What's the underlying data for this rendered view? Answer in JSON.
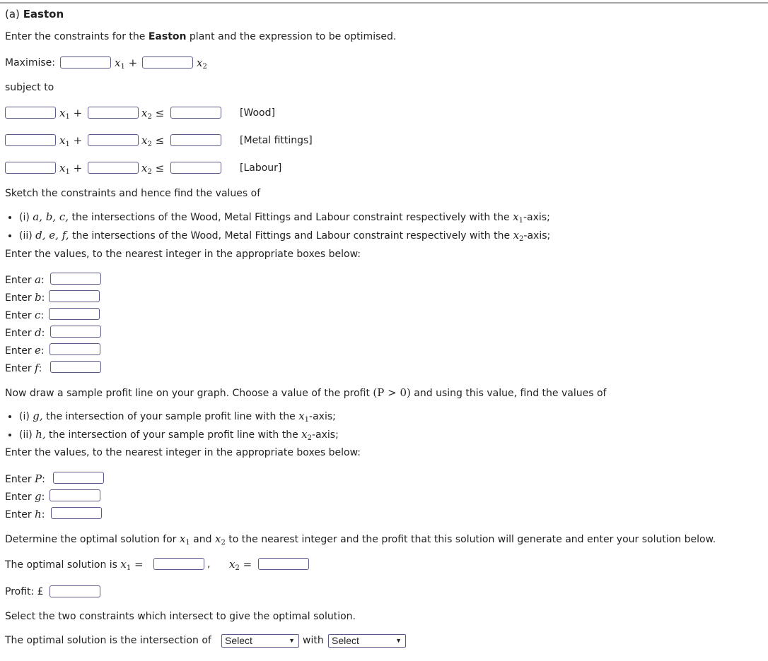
{
  "header": {
    "prefix": "(a)",
    "plant": "Easton"
  },
  "intro": {
    "part1": "Enter the constraints for the ",
    "bold": "Easton",
    "part2": " plant and the expression to be optimised."
  },
  "objective": {
    "label": "Maximise:",
    "x1": "x",
    "x1_sub": "1",
    "plus": "+",
    "x2": "x",
    "x2_sub": "2",
    "coef1": "",
    "coef2": ""
  },
  "subject_to": "subject to",
  "constraints": [
    {
      "name": "[Wood]",
      "a": "",
      "b": "",
      "rhs": ""
    },
    {
      "name": "[Metal fittings]",
      "a": "",
      "b": "",
      "rhs": ""
    },
    {
      "name": "[Labour]",
      "a": "",
      "b": "",
      "rhs": ""
    }
  ],
  "symbols": {
    "x": "x",
    "sub1": "1",
    "sub2": "2",
    "plus": "+",
    "leq": "≤",
    "eq": "="
  },
  "sketch": {
    "intro": "Sketch the constraints and hence find the values of",
    "bullets": [
      {
        "prefix": "(i) ",
        "vars": "a, b, c,",
        "text": " the intersections of the Wood, Metal Fittings and Labour constraint respectively with the ",
        "axis_sub": "1",
        "suffix": "-axis;"
      },
      {
        "prefix": "(ii) ",
        "vars": "d, e, f,",
        "text": " the intersections of the Wood, Metal Fittings and Labour constraint respectively with the ",
        "axis_sub": "2",
        "suffix": "-axis;"
      }
    ],
    "enter_values": "Enter the values, to the nearest integer in the appropriate boxes below:"
  },
  "value_fields": [
    {
      "label": "Enter ",
      "var": "a",
      "value": ""
    },
    {
      "label": "Enter ",
      "var": "b",
      "value": ""
    },
    {
      "label": "Enter ",
      "var": "c",
      "value": ""
    },
    {
      "label": "Enter ",
      "var": "d",
      "value": ""
    },
    {
      "label": "Enter ",
      "var": "e",
      "value": ""
    },
    {
      "label": "Enter ",
      "var": "f",
      "value": ""
    }
  ],
  "profit_line": {
    "intro_a": "Now draw a sample profit line on your graph. Choose a value of the profit ",
    "math": "(P > 0)",
    "intro_b": " and using this value, find the values of",
    "bullets": [
      {
        "prefix": "(i) ",
        "var": "g,",
        "text": " the intersection of your sample profit line with the ",
        "axis_sub": "1",
        "suffix": "-axis;"
      },
      {
        "prefix": "(ii) ",
        "var": "h,",
        "text": " the intersection of your sample profit line with the ",
        "axis_sub": "2",
        "suffix": "-axis;"
      }
    ],
    "enter_values": "Enter the values, to the nearest integer in the appropriate boxes below:"
  },
  "profit_fields": [
    {
      "label": "Enter ",
      "var": "P",
      "value": ""
    },
    {
      "label": "Enter ",
      "var": "g",
      "value": ""
    },
    {
      "label": "Enter ",
      "var": "h",
      "value": ""
    }
  ],
  "optimal": {
    "determine_a": "Determine the optimal solution for ",
    "determine_and": " and ",
    "determine_b": " to the nearest integer and the profit that this solution will generate and enter your solution below.",
    "solution_label": "The optimal solution is ",
    "comma": ",",
    "x1_value": "",
    "x2_value": "",
    "profit_label": "Profit: £",
    "profit_value": ""
  },
  "intersection": {
    "instruction": "Select the two constraints which intersect to give the optimal solution.",
    "label": "The optimal solution is the intersection of",
    "with": "with",
    "select1": "Select",
    "select2": "Select",
    "arrow": "▼"
  }
}
